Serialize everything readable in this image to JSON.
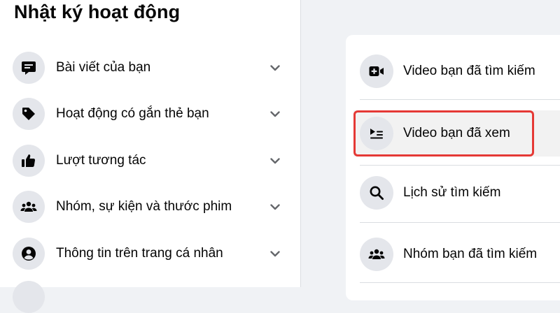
{
  "page_title": "Nhật ký hoạt động",
  "sidebar": {
    "items": [
      {
        "label": "Bài viết của bạn",
        "icon": "post-icon"
      },
      {
        "label": "Hoạt động có gắn thẻ bạn",
        "icon": "tag-icon"
      },
      {
        "label": "Lượt tương tác",
        "icon": "thumbs-up-icon"
      },
      {
        "label": "Nhóm, sự kiện và thước phim",
        "icon": "groups-icon"
      },
      {
        "label": "Thông tin trên trang cá nhân",
        "icon": "profile-icon"
      }
    ]
  },
  "panel": {
    "items": [
      {
        "label": "Video bạn đã tìm kiếm",
        "icon": "video-camera-icon"
      },
      {
        "label": "Video bạn đã xem",
        "icon": "playlist-icon",
        "highlighted": true
      },
      {
        "label": "Lịch sử tìm kiếm",
        "icon": "search-icon"
      },
      {
        "label": "Nhóm bạn đã tìm kiếm",
        "icon": "groups-icon"
      }
    ]
  },
  "colors": {
    "background": "#f0f2f5",
    "surface": "#ffffff",
    "icon_circle": "#e4e6eb",
    "highlight_border": "#e53935",
    "text": "#050505"
  }
}
